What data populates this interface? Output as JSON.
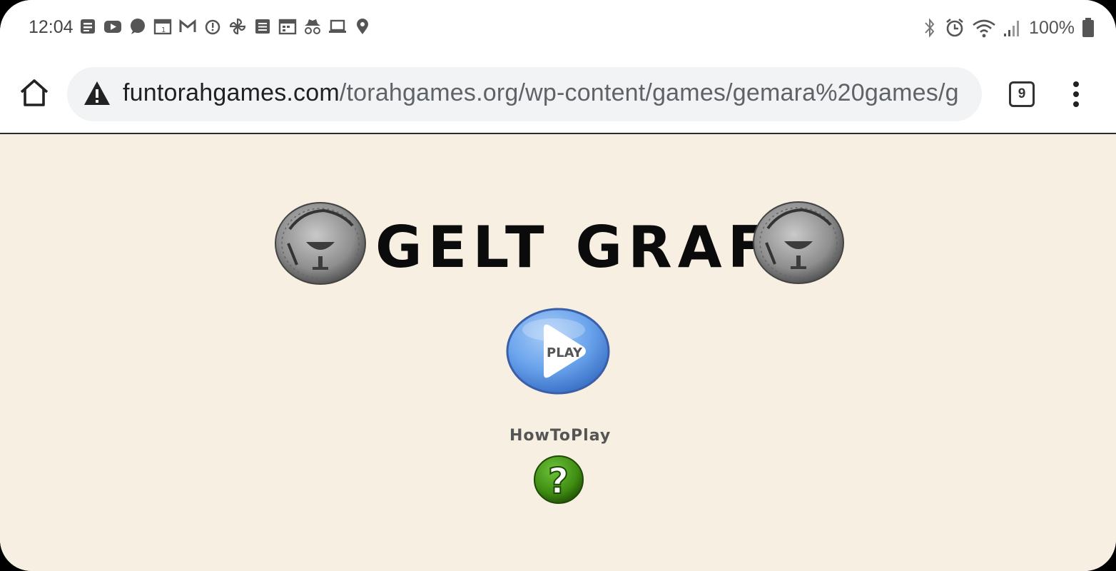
{
  "status_bar": {
    "time": "12:04",
    "battery": "100%",
    "notification_icons": [
      "news-icon",
      "youtube-icon",
      "chat-bubble-icon",
      "calendar-icon",
      "gmail-icon",
      "alarm-icon",
      "pinwheel-icon",
      "notes-icon",
      "calendar-grid-icon",
      "incognito-icon",
      "laptop-icon",
      "location-pin-icon"
    ],
    "system_icons": [
      "bluetooth-icon",
      "alarm-icon",
      "wifi-icon",
      "signal-icon",
      "battery-icon"
    ]
  },
  "browser": {
    "url_domain": "funtorahgames.com",
    "url_path": "/torahgames.org/wp-content/games/gemara%20games/g",
    "tab_count": "9"
  },
  "game": {
    "title": "GELT GRAFT",
    "play_label": "PLAY",
    "howto_label": "HowToPlay",
    "help_symbol": "?"
  },
  "colors": {
    "page_background": "#f6efe2",
    "play_button": "#6aa3ec",
    "help_button": "#3f8c12",
    "coin": "#8e8e8e"
  }
}
